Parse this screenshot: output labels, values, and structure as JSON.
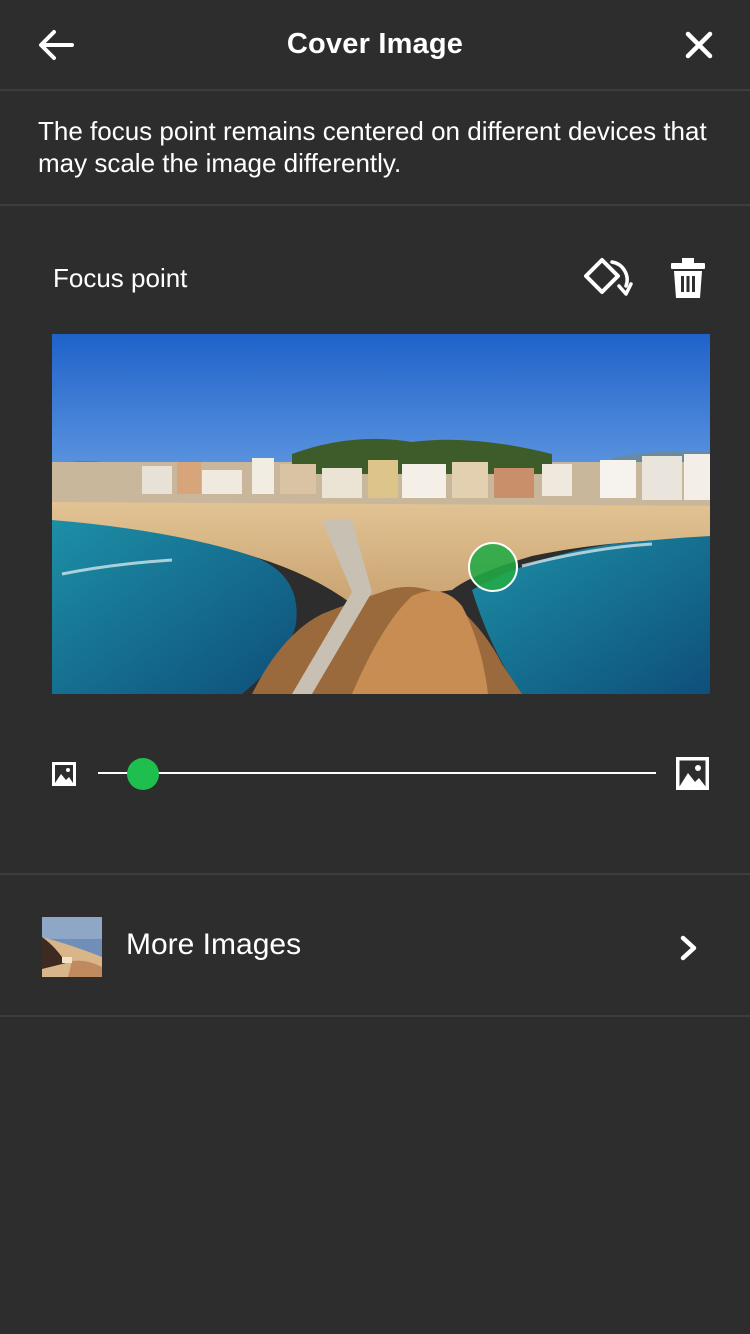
{
  "header": {
    "title": "Cover Image",
    "back_icon": "arrow-left-icon",
    "close_icon": "close-icon"
  },
  "description": "The focus point remains centered on different devices that may scale the image differently.",
  "focus": {
    "label": "Focus point",
    "rotate_icon": "rotate-icon",
    "delete_icon": "trash-icon",
    "accent_color": "#22aa46"
  },
  "zoom_slider": {
    "value_fraction": 0.08,
    "min_icon": "image-small-icon",
    "max_icon": "image-large-icon",
    "thumb_color": "#1fbf4f"
  },
  "more_images": {
    "label": "More Images",
    "chevron_icon": "chevron-right-icon"
  }
}
